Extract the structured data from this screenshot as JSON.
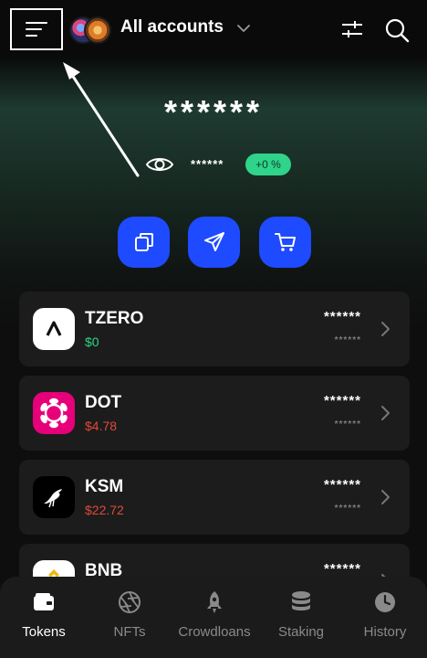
{
  "header": {
    "account_label": "All accounts",
    "menu_icon": "hamburger-menu-icon",
    "filter_icon": "sliders-icon",
    "search_icon": "search-icon"
  },
  "balance": {
    "total_masked": "******",
    "sub_masked": "******",
    "change": "+0 %"
  },
  "actions": [
    {
      "icon": "copy-icon"
    },
    {
      "icon": "send-icon"
    },
    {
      "icon": "cart-icon"
    }
  ],
  "tokens": [
    {
      "symbol": "TZERO",
      "price": "$0",
      "balance": "******",
      "value": "******",
      "price_trend": "up"
    },
    {
      "symbol": "DOT",
      "price": "$4.78",
      "balance": "******",
      "value": "******",
      "price_trend": "down"
    },
    {
      "symbol": "KSM",
      "price": "$22.72",
      "balance": "******",
      "value": "******",
      "price_trend": "down"
    },
    {
      "symbol": "BNB",
      "balance": "******"
    }
  ],
  "nav": [
    {
      "label": "Tokens",
      "icon": "wallet-icon",
      "active": true
    },
    {
      "label": "NFTs",
      "icon": "aperture-icon",
      "active": false
    },
    {
      "label": "Crowdloans",
      "icon": "rocket-icon",
      "active": false
    },
    {
      "label": "Staking",
      "icon": "database-icon",
      "active": false
    },
    {
      "label": "History",
      "icon": "clock-icon",
      "active": false
    }
  ],
  "colors": {
    "accent": "#1e4bff",
    "positive": "#2fd38a",
    "negative": "#e04a3a",
    "card": "#1c1c1c",
    "background": "#0c0c0c"
  }
}
